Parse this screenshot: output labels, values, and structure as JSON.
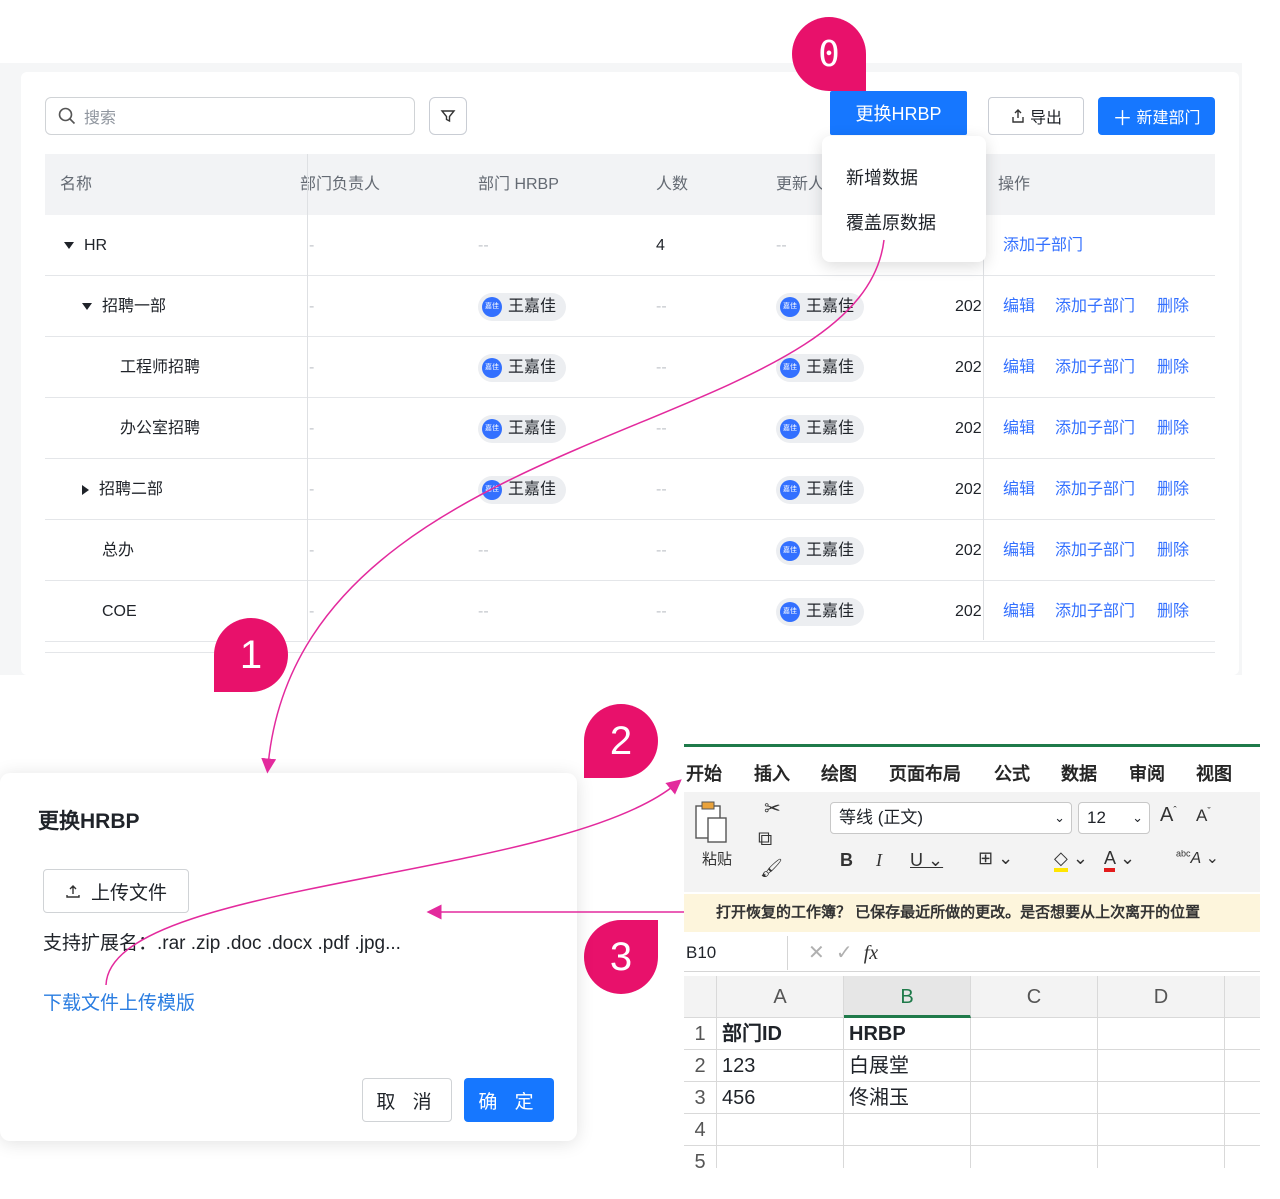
{
  "colors": {
    "primary": "#1677ff",
    "badge": "#e8116b",
    "link": "#3370ff",
    "excel_green": "#1f7a4a",
    "arrow": "#e32a9d"
  },
  "toolbar": {
    "search_placeholder": "搜索",
    "replace_hrbp": "更换HRBP",
    "export": "导出",
    "new_department": "新建部门"
  },
  "dropdown": {
    "items": [
      "新增数据",
      "覆盖原数据"
    ]
  },
  "table": {
    "headers": {
      "name": "名称",
      "owner": "部门负责人",
      "hrbp": "部门 HRBP",
      "count": "人数",
      "updater": "更新人",
      "actions": "操作"
    },
    "dash": "-",
    "empty": "--",
    "rows": [
      {
        "name": "HR",
        "owner": "-",
        "hrbp": "--",
        "count": "4",
        "updater": "--",
        "time": "",
        "actions": [
          "添加子部门"
        ]
      },
      {
        "name": "招聘一部",
        "owner": "-",
        "hrbp": "王嘉佳",
        "count": "--",
        "updater": "王嘉佳",
        "time": "202",
        "actions": [
          "编辑",
          "添加子部门",
          "删除"
        ]
      },
      {
        "name": "工程师招聘",
        "owner": "-",
        "hrbp": "王嘉佳",
        "count": "--",
        "updater": "王嘉佳",
        "time": "202",
        "actions": [
          "编辑",
          "添加子部门",
          "删除"
        ]
      },
      {
        "name": "办公室招聘",
        "owner": "-",
        "hrbp": "王嘉佳",
        "count": "--",
        "updater": "王嘉佳",
        "time": "202",
        "actions": [
          "编辑",
          "添加子部门",
          "删除"
        ]
      },
      {
        "name": "招聘二部",
        "owner": "-",
        "hrbp": "王嘉佳",
        "count": "--",
        "updater": "王嘉佳",
        "time": "202",
        "actions": [
          "编辑",
          "添加子部门",
          "删除"
        ]
      },
      {
        "name": "总办",
        "owner": "-",
        "hrbp": "--",
        "count": "--",
        "updater": "王嘉佳",
        "time": "202",
        "actions": [
          "编辑",
          "添加子部门",
          "删除"
        ]
      },
      {
        "name": "COE",
        "owner": "-",
        "hrbp": "--",
        "count": "--",
        "updater": "王嘉佳",
        "time": "202",
        "actions": [
          "编辑",
          "添加子部门",
          "删除"
        ]
      }
    ],
    "avatar_text": "嘉佳"
  },
  "badges": {
    "b0": "0",
    "b1": "1",
    "b2": "2",
    "b3": "3"
  },
  "dialog": {
    "title": "更换HRBP",
    "upload": "上传文件",
    "extensions": "支持扩展名：.rar .zip .doc .docx .pdf .jpg...",
    "template_link": "下载文件上传模版",
    "cancel": "取 消",
    "ok": "确 定"
  },
  "excel": {
    "tabs": [
      "开始",
      "插入",
      "绘图",
      "页面布局",
      "公式",
      "数据",
      "审阅",
      "视图"
    ],
    "paste": "粘贴",
    "font": "等线 (正文)",
    "size": "12",
    "notice": "打开恢复的工作簿？ 已保存最近所做的更改。是否想要从上次离开的位置",
    "cell_ref": "B10",
    "fx": "fx",
    "columns": [
      "A",
      "B",
      "C",
      "D"
    ],
    "rows": [
      {
        "num": "1",
        "a": "部门ID",
        "b": "HRBP"
      },
      {
        "num": "2",
        "a": "123",
        "b": "白展堂"
      },
      {
        "num": "3",
        "a": "456",
        "b": "佟湘玉"
      },
      {
        "num": "4",
        "a": "",
        "b": ""
      },
      {
        "num": "5",
        "a": "",
        "b": ""
      }
    ]
  }
}
